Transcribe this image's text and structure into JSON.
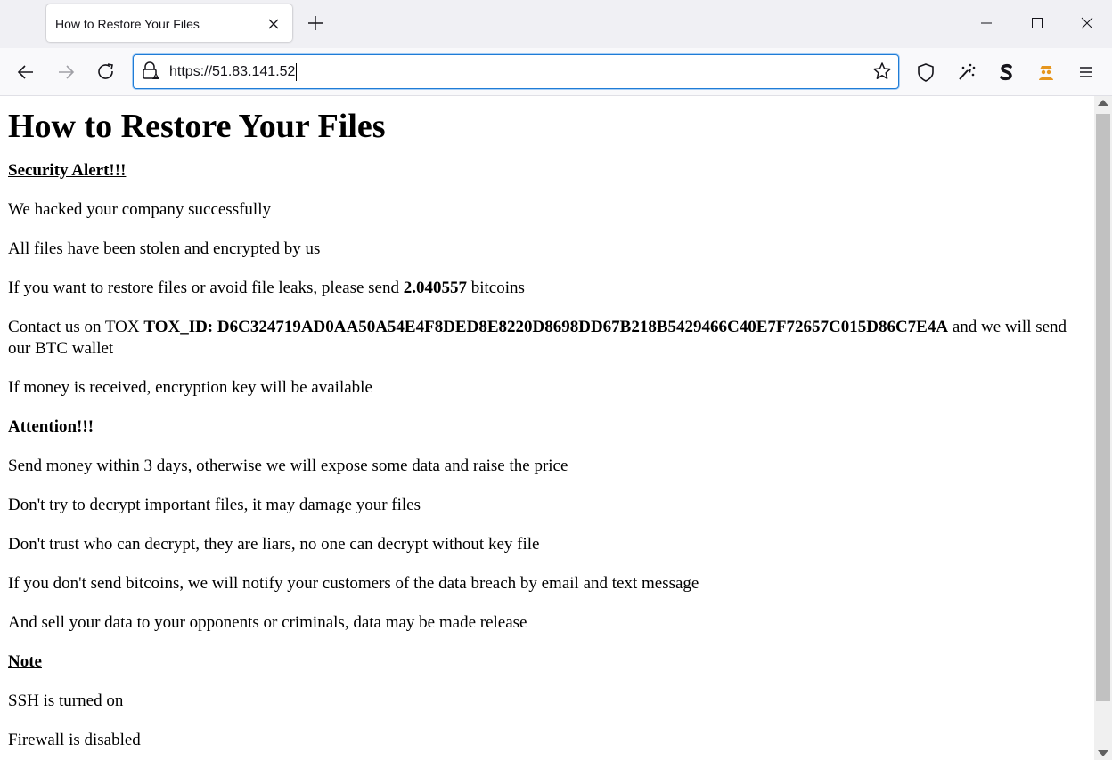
{
  "browser": {
    "tab_title": "How to Restore Your Files",
    "url": "https://51.83.141.52",
    "accent_color": "#1f7cd6",
    "icons": [
      "close-icon",
      "new-tab-icon",
      "minimize-icon",
      "maximize-icon",
      "window-close-icon",
      "back-icon",
      "forward-icon",
      "reload-icon",
      "lock-warning-icon",
      "bookmark-star-icon",
      "shield-icon",
      "extension-icon",
      "s-extension-icon",
      "agent-extension-icon",
      "menu-icon"
    ]
  },
  "page": {
    "title": "How to Restore Your Files",
    "security_heading": "Security Alert!!!",
    "line_hacked": "We hacked your company successfully",
    "line_stolen": "All files have been stolen and encrypted by us",
    "restore_pre": "If you want to restore files or avoid file leaks, please send ",
    "restore_amount": "2.040557",
    "restore_post": " bitcoins",
    "contact_pre": "Contact us on TOX ",
    "contact_id": "TOX_ID: D6C324719AD0AA50A54E4F8DED8E8220D8698DD67B218B5429466C40E7F72657C015D86C7E4A",
    "contact_post": " and we will send our BTC wallet",
    "line_key": "If money is received, encryption key will be available",
    "attention_heading": "Attention!!!",
    "line_3days": "Send money within 3 days, otherwise we will expose some data and raise the price",
    "line_decrypt": "Don't try to decrypt important files, it may damage your files",
    "line_trust": "Don't trust who can decrypt, they are liars, no one can decrypt without key file",
    "line_notify": "If you don't send bitcoins, we will notify your customers of the data breach by email and text message",
    "line_sell": "And sell your data to your opponents or criminals, data may be made release",
    "note_heading": "Note",
    "line_ssh": "SSH is turned on",
    "line_firewall": "Firewall is disabled"
  }
}
